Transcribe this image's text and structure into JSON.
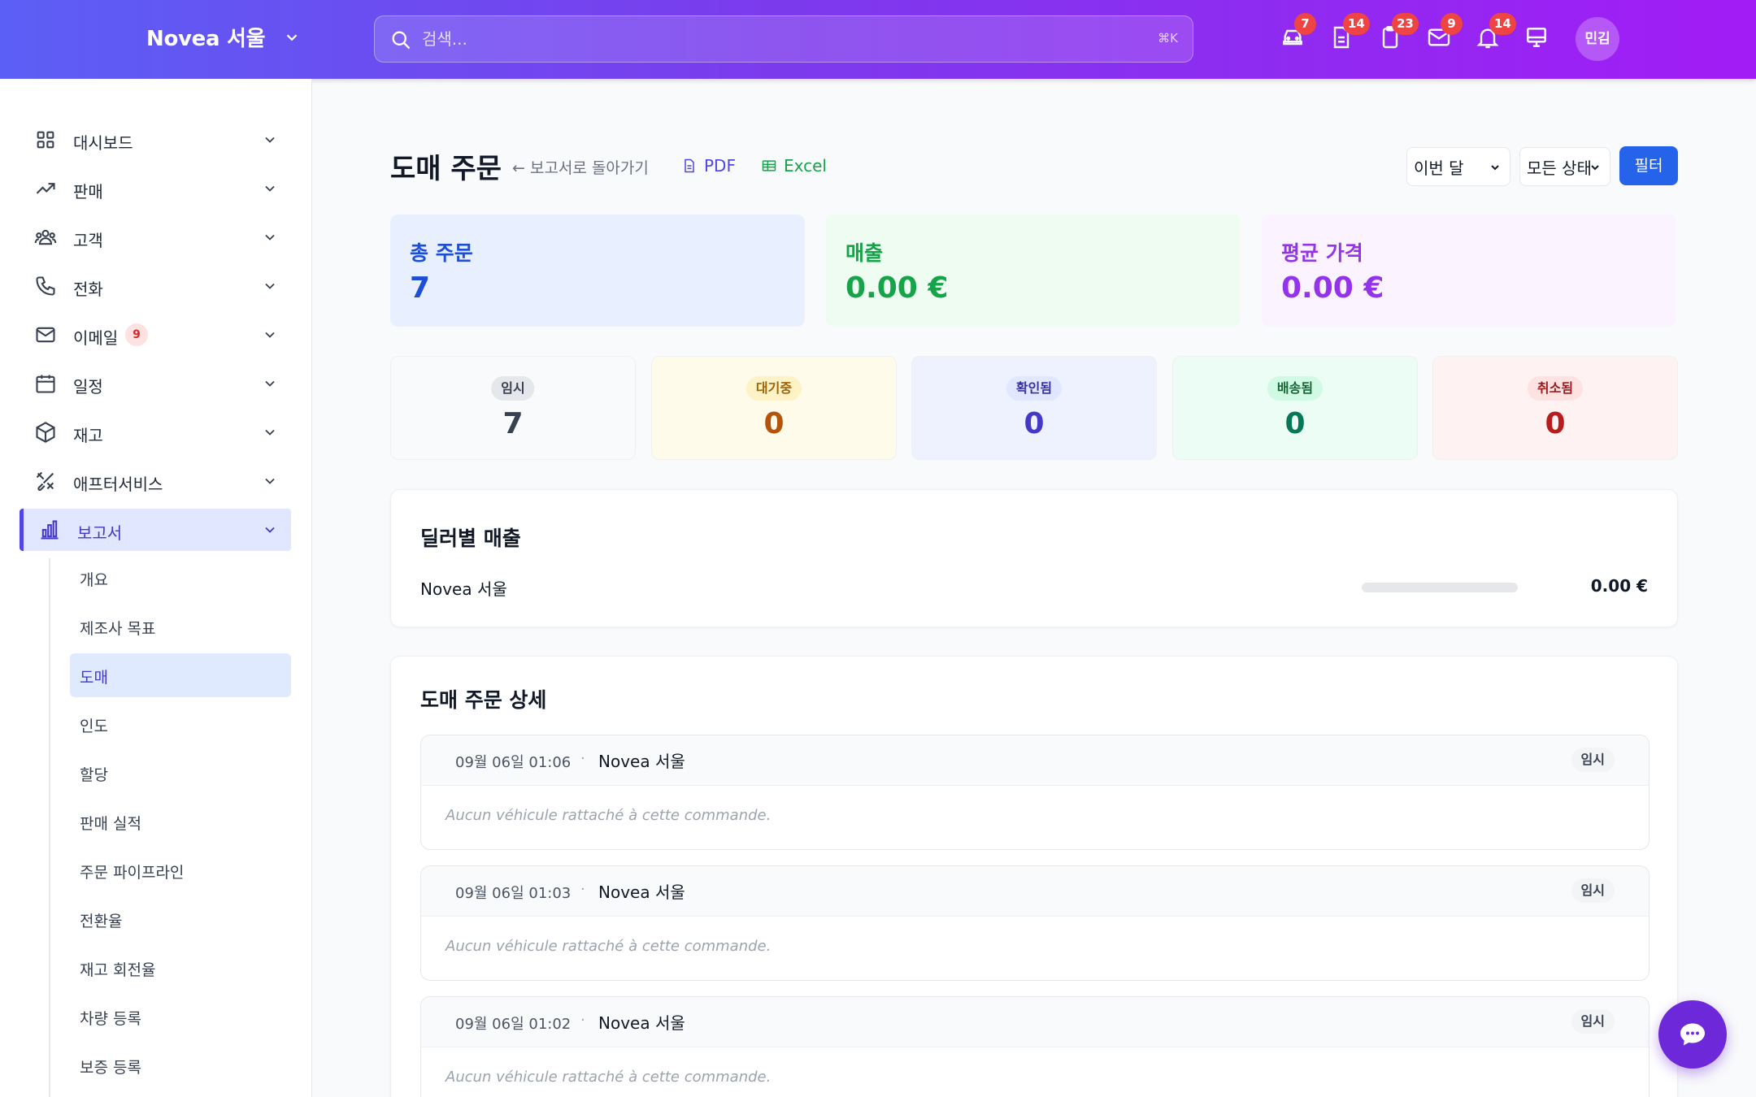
{
  "header": {
    "brand": "Novea 서울",
    "search_placeholder": "검색...",
    "search_shortcut": "⌘K",
    "badges": {
      "cars": "7",
      "documents": "14",
      "clipboard": "23",
      "mail": "9",
      "notifications": "14"
    },
    "avatar_initials": "민김"
  },
  "sidebar": {
    "items": [
      {
        "label": "대시보드",
        "icon": "grid-icon"
      },
      {
        "label": "판매",
        "icon": "trending-up-icon"
      },
      {
        "label": "고객",
        "icon": "users-icon"
      },
      {
        "label": "전화",
        "icon": "phone-icon"
      },
      {
        "label": "이메일",
        "icon": "mail-icon",
        "badge": "9"
      },
      {
        "label": "일정",
        "icon": "calendar-icon"
      },
      {
        "label": "재고",
        "icon": "box-icon"
      },
      {
        "label": "애프터서비스",
        "icon": "tools-icon"
      },
      {
        "label": "보고서",
        "icon": "bar-chart-icon",
        "active": true
      }
    ],
    "report_sub": [
      "개요",
      "제조사 목표",
      "도매",
      "인도",
      "할당",
      "판매 실적",
      "주문 파이프라인",
      "전환율",
      "재고 회전율",
      "차량 등록",
      "보증 등록"
    ],
    "active_sub": "도매"
  },
  "page": {
    "title": "도매 주문",
    "back": "← 보고서로 돌아가기",
    "pdf": "PDF",
    "excel": "Excel",
    "period": "이번 달",
    "status_filter": "모든 상태",
    "filter_btn": "필터"
  },
  "kpis": [
    {
      "label": "총 주문",
      "value": "7",
      "color": "#1d4ed8",
      "bg": "#e8efff"
    },
    {
      "label": "매출",
      "value": "0.00 €",
      "color": "#16a34a",
      "bg": "#eefcf2"
    },
    {
      "label": "평균 가격",
      "value": "0.00 €",
      "color": "#9333ea",
      "bg": "#fbf3ff"
    }
  ],
  "status_counts": [
    {
      "label": "임시",
      "value": "7",
      "text": "#374151",
      "pill": "#e5e7eb",
      "bg": "#f9fafb",
      "num": "#374151"
    },
    {
      "label": "대기중",
      "value": "0",
      "text": "#a16207",
      "pill": "#fef3c7",
      "bg": "#fffbeb",
      "num": "#b45309"
    },
    {
      "label": "확인됨",
      "value": "0",
      "text": "#3730a3",
      "pill": "#e0e7ff",
      "bg": "#eef2ff",
      "num": "#4338ca"
    },
    {
      "label": "배송됨",
      "value": "0",
      "text": "#166534",
      "pill": "#d1fae5",
      "bg": "#ecfdf5",
      "num": "#047857"
    },
    {
      "label": "취소됨",
      "value": "0",
      "text": "#991b1b",
      "pill": "#fee2e2",
      "bg": "#fef2f2",
      "num": "#b91c1c"
    }
  ],
  "dealer_sales": {
    "title": "딜러별 매출",
    "rows": [
      {
        "dealer": "Novea 서울",
        "amount": "0.00 €",
        "share": 0
      }
    ]
  },
  "order_details": {
    "title": "도매 주문 상세",
    "orders": [
      {
        "date": "09월 06일 01:06",
        "dealer": "Novea 서울",
        "status": "임시",
        "note": "Aucun véhicule rattaché à cette commande."
      },
      {
        "date": "09월 06일 01:03",
        "dealer": "Novea 서울",
        "status": "임시",
        "note": "Aucun véhicule rattaché à cette commande."
      },
      {
        "date": "09월 06일 01:02",
        "dealer": "Novea 서울",
        "status": "임시",
        "note": "Aucun véhicule rattaché à cette commande."
      }
    ]
  },
  "separator": "·"
}
